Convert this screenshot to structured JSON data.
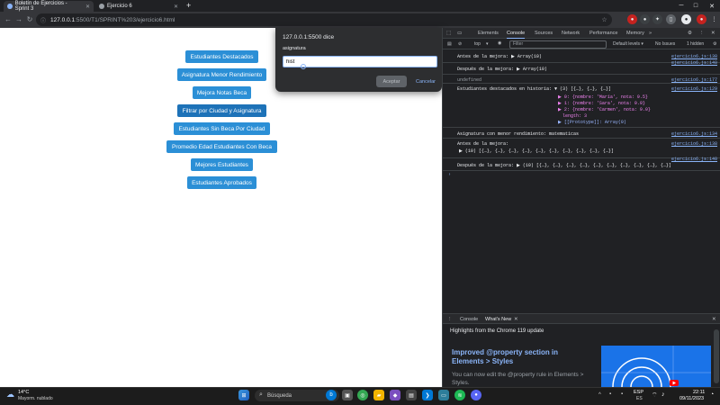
{
  "browser": {
    "tabs": [
      {
        "title": "Boletín de Ejercicios - Sprint 3",
        "active": true
      },
      {
        "title": "Ejercicio 6",
        "active": false
      }
    ],
    "url_host": "127.0.0.1",
    "url_path": ":5500/T1/SPRINT%203/ejercicio6.html",
    "new_tab_label": "+"
  },
  "page": {
    "buttons": [
      "Estudiantes Destacados",
      "Asignatura Menor Rendimiento",
      "Mejora Notas Beca",
      "Filtrar por Ciudad y Asignatura",
      "Estudiantes Sin Beca Por Ciudad",
      "Promedio Edad Estudiantes Con Beca",
      "Mejores Estudiantes",
      "Estudiantes Aprobados"
    ]
  },
  "dialog": {
    "title": "127.0.0.1:5500 dice",
    "message": "asignatura",
    "input_value": "hist",
    "ok_label": "Aceptar",
    "cancel_label": "Cancelar"
  },
  "devtools": {
    "tabs": [
      "Elements",
      "Console",
      "Sources",
      "Network",
      "Performance",
      "Memory",
      "»"
    ],
    "active_tab": "Console",
    "context": "top",
    "filter_placeholder": "Filter",
    "levels": "Default levels ▾",
    "issues": "No Issues",
    "hidden": "1 hidden",
    "console": [
      {
        "msg": "Antes de la mejora:  ▶ Array(10)",
        "src": "ejercicio6.js:138"
      },
      {
        "msg": "Después de la mejora:  ▶ Array(10)",
        "src": "ejercicio6.js:140"
      },
      {
        "msg": "undefined",
        "src": "ejercicio6.js:177"
      },
      {
        "msg": "Estudiantes destacados en historia:  ▼ (3) [{…}, {…}, {…}]",
        "src": "ejercicio6.js:129"
      },
      {
        "msg": "▶ 0: {nombre: 'María', nota: 9.5}",
        "src": ""
      },
      {
        "msg": "▶ 1: {nombre: 'Sara', nota: 9.9}",
        "src": ""
      },
      {
        "msg": "▶ 2: {nombre: 'Carmen', nota: 9.0}",
        "src": ""
      },
      {
        "msg": "length: 3",
        "src": ""
      },
      {
        "msg": "▶ [[Prototype]]: Array(0)",
        "src": ""
      },
      {
        "msg": "Asignatura con menor rendimiento: matematicas",
        "src": "ejercicio6.js:134"
      },
      {
        "msg": "Antes de la mejora:",
        "src": "ejercicio6.js:138"
      },
      {
        "msg": "▶ (10) [{…}, {…}, {…}, {…}, {…}, {…}, {…}, {…}, {…}, {…}]",
        "src": ""
      },
      {
        "msg": "Después de la mejora:  ▶ (10) [{…}, {…}, {…}, {…}, {…}, {…}, {…}, {…}, {…}, {…}]",
        "src": "ejercicio6.js:140"
      },
      {
        "msg": "›",
        "src": ""
      }
    ],
    "drawer_tabs": [
      "Console",
      "What's New"
    ],
    "drawer_active": "What's New",
    "whats_new": {
      "header": "Highlights from the Chrome 119 update",
      "heading": "Improved @property section in Elements > Styles",
      "body": "You can now edit the @property rule in Elements > Styles."
    }
  },
  "taskbar": {
    "weather_temp": "14°C",
    "weather_desc": "Mayorm. nublado",
    "search_placeholder": "Búsqueda",
    "lang": "ESP",
    "lang2": "ES",
    "time": "22:11",
    "date": "09/11/2023"
  }
}
